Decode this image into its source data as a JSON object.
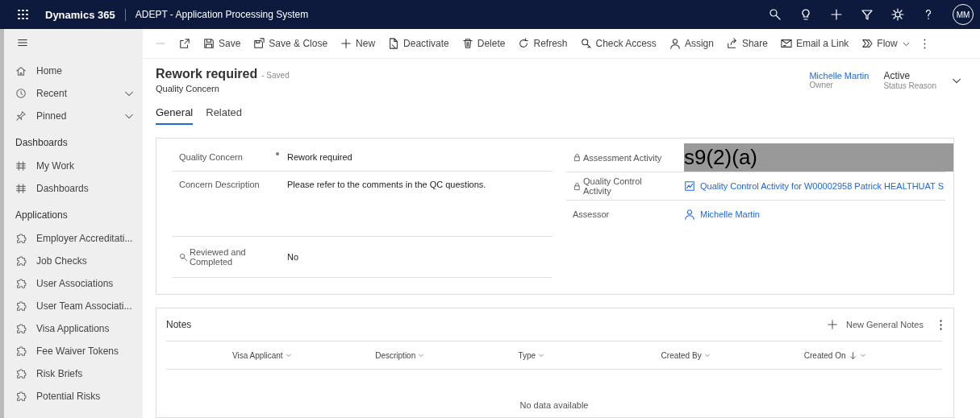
{
  "top_bar": {
    "product": "Dynamics 365",
    "app_title": "ADEPT - Application Processing System",
    "avatar": "MM"
  },
  "sidebar": {
    "groups": [
      {
        "items": [
          {
            "label": "Home",
            "kind": "home",
            "chevron": false
          },
          {
            "label": "Recent",
            "kind": "recent",
            "chevron": true
          },
          {
            "label": "Pinned",
            "kind": "pinned",
            "chevron": true
          }
        ]
      },
      {
        "heading": "Dashboards",
        "items": [
          {
            "label": "My Work",
            "kind": "dashboard",
            "chevron": false
          },
          {
            "label": "Dashboards",
            "kind": "dashboard",
            "chevron": false
          }
        ]
      },
      {
        "heading": "Applications",
        "items": [
          {
            "label": "Employer Accreditati...",
            "kind": "entity",
            "chevron": false
          },
          {
            "label": "Job Checks",
            "kind": "entity",
            "chevron": false
          },
          {
            "label": "User Associations",
            "kind": "entity",
            "chevron": false
          },
          {
            "label": "User Team Associati...",
            "kind": "entity",
            "chevron": false
          },
          {
            "label": "Visa Applications",
            "kind": "entity",
            "chevron": false
          },
          {
            "label": "Fee Waiver Tokens",
            "kind": "entity",
            "chevron": false
          },
          {
            "label": "Risk Briefs",
            "kind": "entity",
            "chevron": false
          },
          {
            "label": "Potential Risks",
            "kind": "entity",
            "chevron": false
          }
        ]
      }
    ]
  },
  "command_bar": [
    {
      "kind": "back",
      "disabled": true,
      "dropdown": false
    },
    {
      "kind": "popout",
      "disabled": false,
      "dropdown": false
    },
    {
      "kind": "save",
      "label": "Save",
      "disabled": false,
      "dropdown": false
    },
    {
      "kind": "saveclose",
      "label": "Save & Close",
      "disabled": false,
      "dropdown": false
    },
    {
      "kind": "new",
      "label": "New",
      "disabled": false,
      "dropdown": false
    },
    {
      "kind": "deactivate",
      "label": "Deactivate",
      "disabled": false,
      "dropdown": false
    },
    {
      "kind": "delete",
      "label": "Delete",
      "disabled": false,
      "dropdown": false
    },
    {
      "kind": "refresh",
      "label": "Refresh",
      "disabled": false,
      "dropdown": false
    },
    {
      "kind": "access",
      "label": "Check Access",
      "disabled": false,
      "dropdown": false
    },
    {
      "kind": "assign",
      "label": "Assign",
      "disabled": false,
      "dropdown": false
    },
    {
      "kind": "share",
      "label": "Share",
      "disabled": false,
      "dropdown": false
    },
    {
      "kind": "email",
      "label": "Email a Link",
      "disabled": false,
      "dropdown": false
    },
    {
      "kind": "flow",
      "label": "Flow",
      "disabled": false,
      "dropdown": true
    },
    {
      "kind": "more",
      "disabled": false,
      "dropdown": false
    }
  ],
  "record": {
    "title": "Rework required",
    "save_state": "- Saved",
    "entity": "Quality Concern",
    "header_fields": [
      {
        "value": "Michelle Martin",
        "label": "Owner",
        "kind": "link"
      },
      {
        "value": "Active",
        "label": "Status Reason",
        "kind": "text"
      }
    ]
  },
  "tabs": [
    {
      "label": "General",
      "selected": true
    },
    {
      "label": "Related",
      "selected": false
    }
  ],
  "form": {
    "left": [
      {
        "label": "Quality Concern",
        "required": true,
        "locked": false,
        "searchable": false,
        "kind": "text",
        "value": "Rework required"
      },
      {
        "label": "Concern Description",
        "required": false,
        "locked": false,
        "searchable": false,
        "kind": "multiline",
        "value": "Please refer to the comments in the QC questions."
      },
      {
        "label": "Reviewed and Completed",
        "required": false,
        "locked": false,
        "searchable": true,
        "kind": "text",
        "value": "No"
      }
    ],
    "right": [
      {
        "label": "Assessment Activity",
        "required": false,
        "locked": true,
        "searchable": false,
        "kind": "redacted",
        "value": "s9(2)(a)"
      },
      {
        "label": "Quality Control Activity",
        "required": false,
        "locked": true,
        "searchable": false,
        "kind": "activity",
        "value": "Quality Control Activity for W00002958 Patrick HEALTHUAT S"
      },
      {
        "label": "Assessor",
        "required": false,
        "locked": false,
        "searchable": false,
        "kind": "person",
        "value": "Michelle Martin"
      }
    ]
  },
  "notes": {
    "title": "Notes",
    "new_button": "New General Notes",
    "columns": [
      {
        "label": "Visa Applicant",
        "sorted": false
      },
      {
        "label": "Description",
        "sorted": false
      },
      {
        "label": "Type",
        "sorted": false
      },
      {
        "label": "Created By",
        "sorted": false
      },
      {
        "label": "Created On",
        "sorted": true
      }
    ],
    "empty_text": "No data available"
  }
}
